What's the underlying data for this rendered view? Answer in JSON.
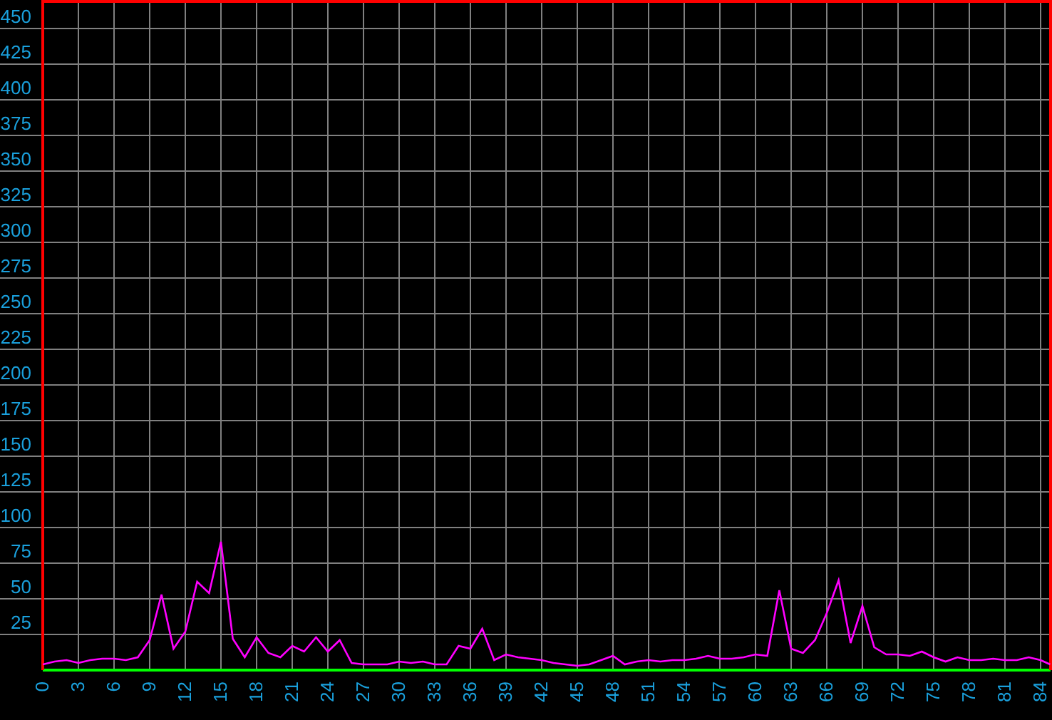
{
  "chart_data": {
    "type": "line",
    "x": [
      0,
      1,
      2,
      3,
      4,
      5,
      6,
      7,
      8,
      9,
      10,
      11,
      12,
      13,
      14,
      15,
      16,
      17,
      18,
      19,
      20,
      21,
      22,
      23,
      24,
      25,
      26,
      27,
      28,
      29,
      30,
      31,
      32,
      33,
      34,
      35,
      36,
      37,
      38,
      39,
      40,
      41,
      42,
      43,
      44,
      45,
      46,
      47,
      48,
      49,
      50,
      51,
      52,
      53,
      54,
      55,
      56,
      57,
      58,
      59,
      60,
      61,
      62,
      63,
      64,
      65,
      66,
      67,
      68,
      69,
      70,
      71,
      72,
      73,
      74,
      75,
      76,
      77,
      78,
      79,
      80,
      81,
      82,
      83,
      84,
      84.8
    ],
    "series": [
      {
        "color": "#ff00ff",
        "values": [
          4,
          6,
          7,
          5,
          7,
          8,
          8,
          7,
          9,
          21,
          53,
          15,
          27,
          62,
          54,
          90,
          22,
          9,
          23,
          12,
          9,
          17,
          13,
          23,
          13,
          21,
          5,
          4,
          4,
          4,
          6,
          5,
          6,
          4,
          4,
          17,
          15,
          29,
          7,
          11,
          9,
          8,
          7,
          5,
          4,
          3,
          4,
          7,
          10,
          4,
          6,
          7,
          6,
          7,
          7,
          8,
          10,
          8,
          8,
          9,
          11,
          10,
          56,
          15,
          12,
          21,
          40,
          63,
          19,
          45,
          16,
          11,
          11,
          10,
          13,
          9,
          6,
          9,
          7,
          7,
          8,
          7,
          7,
          9,
          7,
          4
        ]
      }
    ],
    "grid": true,
    "xlim": [
      0,
      84.84
    ],
    "ylim": [
      0,
      470
    ],
    "xticks": [
      0,
      3,
      6,
      9,
      12,
      15,
      18,
      21,
      24,
      27,
      30,
      33,
      36,
      39,
      42,
      45,
      48,
      51,
      54,
      57,
      60,
      63,
      66,
      69,
      72,
      75,
      78,
      81,
      84
    ],
    "yticks": [
      25,
      50,
      75,
      100,
      125,
      150,
      175,
      200,
      225,
      250,
      275,
      300,
      325,
      350,
      375,
      400,
      425,
      450
    ]
  }
}
